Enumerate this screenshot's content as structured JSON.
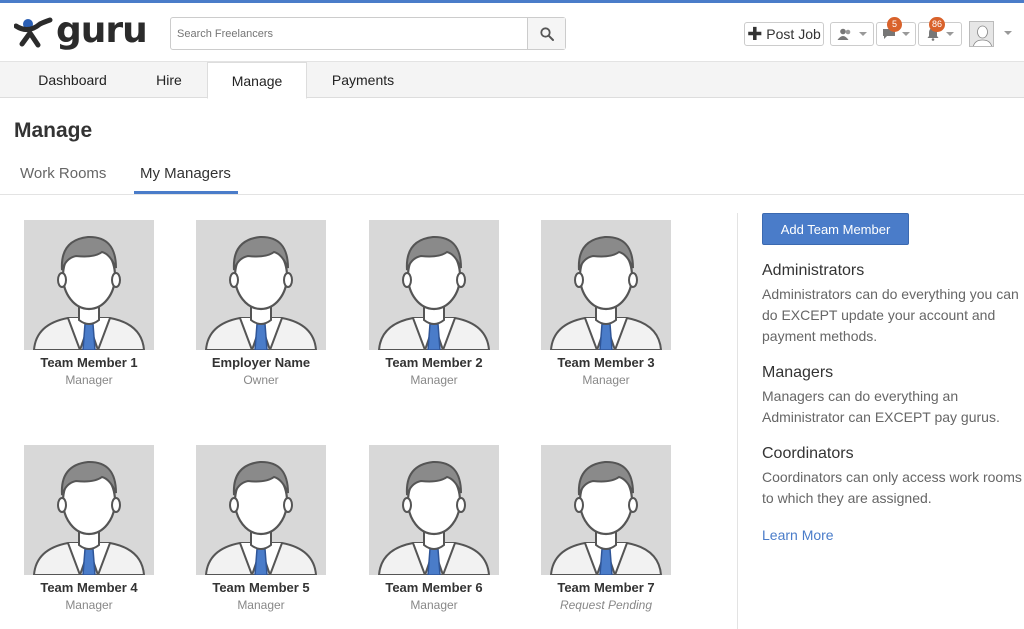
{
  "header": {
    "logo_text": "guru",
    "search_placeholder": "Search Freelancers",
    "post_job_label": "Post Job",
    "messages_badge": "5",
    "notifications_badge": "86"
  },
  "nav": {
    "tabs": [
      {
        "label": "Dashboard"
      },
      {
        "label": "Hire"
      },
      {
        "label": "Manage"
      },
      {
        "label": "Payments"
      }
    ]
  },
  "page": {
    "title": "Manage",
    "subtabs": [
      {
        "label": "Work Rooms"
      },
      {
        "label": "My Managers"
      }
    ]
  },
  "members": [
    {
      "name": "Team Member 1",
      "role": "Manager"
    },
    {
      "name": "Employer Name",
      "role": "Owner"
    },
    {
      "name": "Team Member 2",
      "role": "Manager"
    },
    {
      "name": "Team Member 3",
      "role": "Manager"
    },
    {
      "name": "Team Member 4",
      "role": "Manager"
    },
    {
      "name": "Team Member 5",
      "role": "Manager"
    },
    {
      "name": "Team Member 6",
      "role": "Manager"
    },
    {
      "name": "Team Member 7",
      "role": "Request Pending"
    }
  ],
  "sidebar": {
    "add_button": "Add Team Member",
    "sections": [
      {
        "title": "Administrators",
        "text": "Administrators can do everything you can do EXCEPT update your account and payment methods."
      },
      {
        "title": "Managers",
        "text": "Managers can do everything an Administrator can EXCEPT pay gurus."
      },
      {
        "title": "Coordinators",
        "text": "Coordinators can only access work rooms to which they are assigned."
      }
    ],
    "learn_more": "Learn More"
  },
  "colors": {
    "accent": "#4a7cc9",
    "badge": "#d9622b"
  }
}
